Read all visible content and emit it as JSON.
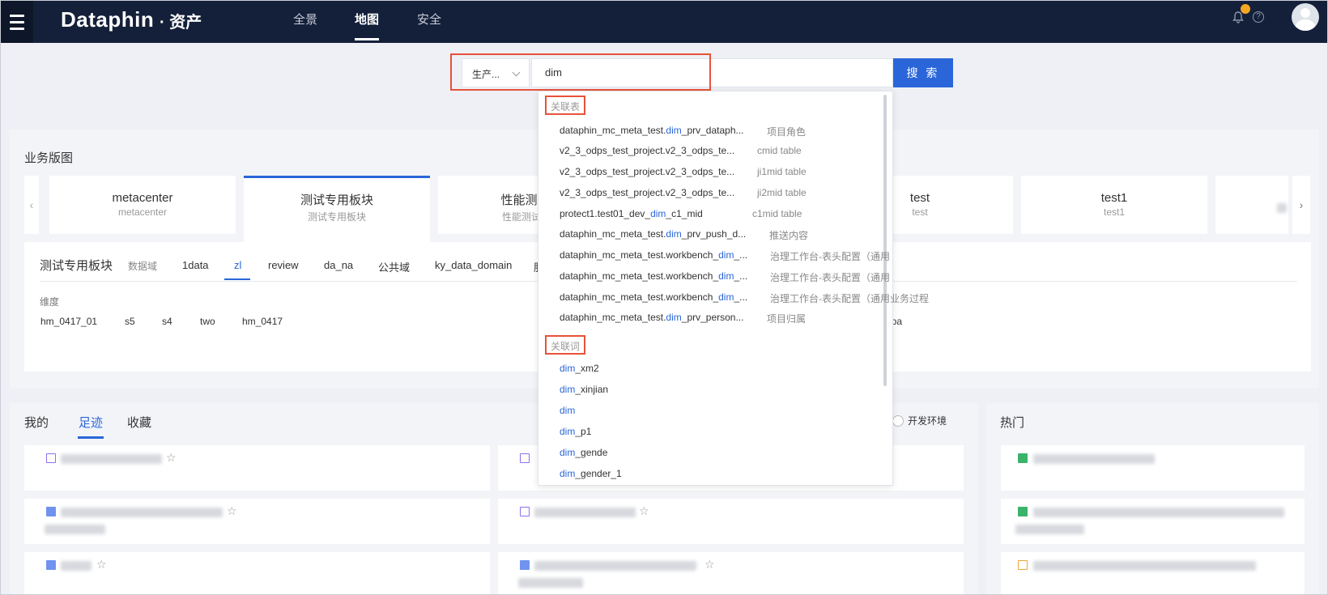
{
  "topbar": {
    "logo": "Dataphin",
    "logo_sub": "· 资产",
    "nav": [
      "全景",
      "地图",
      "安全"
    ],
    "active_nav": "地图"
  },
  "search": {
    "env_value": "生产...",
    "query": "dim",
    "button": "搜 索"
  },
  "business_map": {
    "title": "业务版图",
    "cards": [
      {
        "name": "metacenter",
        "sub": "metacenter"
      },
      {
        "name": "测试专用板块",
        "sub": "测试专用板块"
      },
      {
        "name": "性能测试板",
        "sub": "性能测试板块"
      },
      {
        "name": "test",
        "sub": "test"
      },
      {
        "name": "test1",
        "sub": "test1"
      }
    ],
    "domain_title": "测试专用板块",
    "domain_label": "数据域",
    "domain_tabs": [
      "1data",
      "zl",
      "review",
      "da_na",
      "公共域",
      "ky_data_domain",
      "服"
    ],
    "active_tab": "zl",
    "dimension_label": "维度",
    "dimensions": [
      "hm_0417_01",
      "s5",
      "s4",
      "two",
      "hm_0417"
    ],
    "trailing_dimension": "ppa"
  },
  "bottom": {
    "tabs": [
      "我的",
      "足迹",
      "收藏"
    ],
    "active_tab": "足迹",
    "env_option": "开发环境",
    "hot_title": "热门"
  },
  "dropdown": {
    "group_tables": "关联表",
    "tables": [
      {
        "pre": "dataphin_mc_meta_test.",
        "hl": "dim",
        "post": "_prv_dataph...",
        "desc": "项目角色"
      },
      {
        "pre": "v2_3_odps_test_project.v2_3_odps_te...",
        "hl": "",
        "post": "",
        "desc": "cmid table"
      },
      {
        "pre": "v2_3_odps_test_project.v2_3_odps_te...",
        "hl": "",
        "post": "",
        "desc": "ji1mid table"
      },
      {
        "pre": "v2_3_odps_test_project.v2_3_odps_te...",
        "hl": "",
        "post": "",
        "desc": "ji2mid table"
      },
      {
        "pre": "protect1.test01_dev_",
        "hl": "dim",
        "post": "_c1_mid",
        "desc": "c1mid table"
      },
      {
        "pre": "dataphin_mc_meta_test.",
        "hl": "dim",
        "post": "_prv_push_d...",
        "desc": "推送内容"
      },
      {
        "pre": "dataphin_mc_meta_test.workbench_",
        "hl": "dim",
        "post": "_...",
        "desc": "治理工作台-表头配置（通用"
      },
      {
        "pre": "dataphin_mc_meta_test.workbench_",
        "hl": "dim",
        "post": "_...",
        "desc": "治理工作台-表头配置（通用"
      },
      {
        "pre": "dataphin_mc_meta_test.workbench_",
        "hl": "dim",
        "post": "_...",
        "desc": "治理工作台-表头配置（通用业务过程"
      },
      {
        "pre": "dataphin_mc_meta_test.",
        "hl": "dim",
        "post": "_prv_person...",
        "desc": "项目归属"
      }
    ],
    "group_words": "关联词",
    "words": [
      {
        "hl": "dim",
        "post": "_xm2"
      },
      {
        "hl": "dim",
        "post": "_xinjian"
      },
      {
        "hl": "dim",
        "post": ""
      },
      {
        "hl": "dim",
        "post": "_p1"
      },
      {
        "hl": "dim",
        "post": "_gende"
      },
      {
        "hl": "dim",
        "post": "_gender_1"
      }
    ]
  },
  "colors": {
    "nav_bg": "#14203a",
    "accent": "#2a66d9",
    "highlight_border": "#e8523a",
    "notification": "#f5a623"
  }
}
